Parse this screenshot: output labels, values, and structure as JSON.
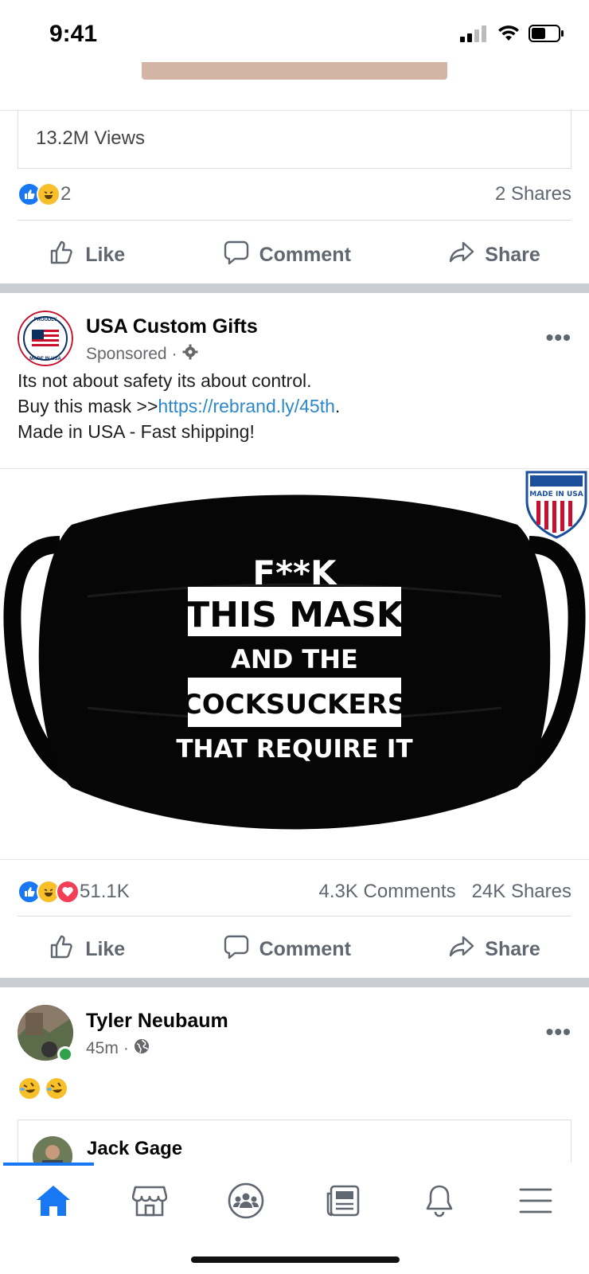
{
  "status_bar": {
    "time": "9:41",
    "icons": [
      "signal-icon",
      "wifi-icon",
      "battery-icon"
    ]
  },
  "prev_post": {
    "views": "13.2M Views",
    "reactions": {
      "icons": [
        "like",
        "haha"
      ],
      "count": "2"
    },
    "shares": "2 Shares",
    "actions": {
      "like": "Like",
      "comment": "Comment",
      "share": "Share"
    }
  },
  "ad_post": {
    "author": "USA Custom Gifts",
    "sponsored": "Sponsored",
    "text_line1": "Its not about safety its about control.",
    "text_line2_prefix": "Buy this mask >>",
    "link": "https://rebrand.ly/45th",
    "text_line2_suffix": ".",
    "text_line3": "Made in USA - Fast shipping!",
    "avatar_lettering": "PROUDLY MADE IN USA",
    "image": {
      "badge": "MADE IN USA",
      "mask_lines": [
        "F**K",
        "THIS MASK",
        "AND THE",
        "COCKSUCKERS",
        "THAT REQUIRE IT"
      ]
    },
    "reactions": {
      "icons": [
        "like",
        "haha",
        "love"
      ],
      "count": "51.1K"
    },
    "comments": "4.3K Comments",
    "shares": "24K Shares",
    "actions": {
      "like": "Like",
      "comment": "Comment",
      "share": "Share"
    }
  },
  "third_post": {
    "author": "Tyler Neubaum",
    "time": "45m",
    "privacy_icon": "globe-icon",
    "emoji": "🤣🤣",
    "shared_author": "Jack Gage"
  },
  "bottom_nav": {
    "items": [
      "home-icon",
      "marketplace-icon",
      "groups-icon",
      "news-icon",
      "bell-icon",
      "menu-icon"
    ],
    "active": "home-icon"
  },
  "colors": {
    "accent": "#1877f2",
    "link": "#2d88c8",
    "secondary_text": "#65676b",
    "separator": "#c9ccd1"
  }
}
